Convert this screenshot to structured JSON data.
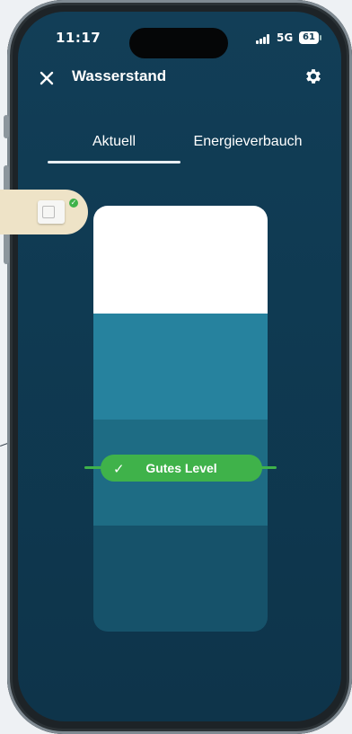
{
  "status_bar": {
    "time": "11:17",
    "network": "5G",
    "battery": "61"
  },
  "header": {
    "title": "Wasserstand",
    "close_icon": "close-icon",
    "settings_icon": "gear-icon"
  },
  "tabs": [
    {
      "label": "Aktuell",
      "active": true
    },
    {
      "label": "Energieverbauch",
      "active": false
    }
  ],
  "tank": {
    "colors": {
      "empty": "#ffffff",
      "upper": "#26829e",
      "good": "#1e6c84",
      "lower": "#16526a"
    }
  },
  "level_indicator": {
    "label": "Gutes Level",
    "icon": "check-icon",
    "color": "#3fb24a"
  },
  "device_badge": {
    "icon": "device-icon",
    "status_icon": "check-icon"
  }
}
